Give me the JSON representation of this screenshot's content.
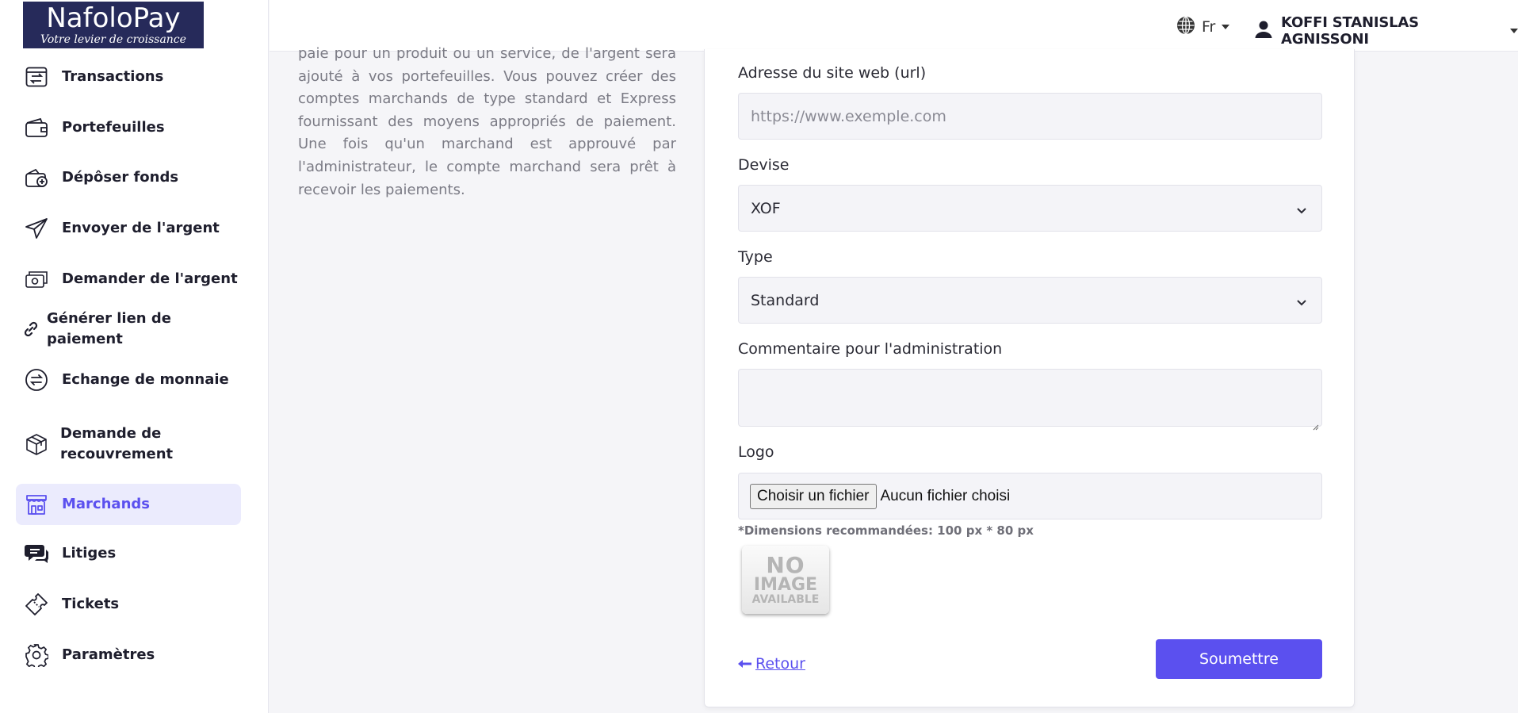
{
  "brand": {
    "name": "NafoloPay",
    "tagline": "Votre levier de croissance"
  },
  "sidebar": {
    "items": [
      {
        "label": "Transactions",
        "icon": "transactions-icon"
      },
      {
        "label": "Portefeuilles",
        "icon": "wallet-icon"
      },
      {
        "label": "Dépôser fonds",
        "icon": "deposit-wallet-icon"
      },
      {
        "label": "Envoyer de l'argent",
        "icon": "paper-plane-icon"
      },
      {
        "label": "Demander de l'argent",
        "icon": "money-request-icon"
      },
      {
        "label": "Générer lien de paiement",
        "icon": "link-icon"
      },
      {
        "label": "Echange de monnaie",
        "icon": "exchange-icon"
      },
      {
        "label": "Demande de recouvrement",
        "icon": "box-icon"
      },
      {
        "label": "Marchands",
        "icon": "store-icon",
        "active": true
      },
      {
        "label": "Litiges",
        "icon": "chat-icon"
      },
      {
        "label": "Tickets",
        "icon": "ticket-icon"
      },
      {
        "label": "Paramètres",
        "icon": "gear-icon"
      }
    ]
  },
  "header": {
    "language": "Fr",
    "user_name": "KOFFI STANISLAS AGNISSONI"
  },
  "intro_text": "paie pour un produit ou un service, de l'argent sera ajouté à vos portefeuilles. Vous pouvez créer des comptes marchands de type standard et Express fournissant des moyens appropriés de paiement. Une fois qu'un marchand est approuvé par l'administrateur, le compte marchand sera prêt à recevoir les paiements.",
  "form": {
    "website": {
      "label": "Adresse du site web (url)",
      "value": "",
      "placeholder": "https://www.exemple.com"
    },
    "currency": {
      "label": "Devise",
      "selected": "XOF"
    },
    "type": {
      "label": "Type",
      "selected": "Standard"
    },
    "comment": {
      "label": "Commentaire pour l'administration",
      "value": ""
    },
    "logo": {
      "label": "Logo",
      "button_label": "Choisir un fichier",
      "status": "Aucun fichier choisi",
      "hint": "*Dimensions recommandées: 100 px * 80 px",
      "placeholder_lines": [
        "NO",
        "IMAGE",
        "AVAILABLE"
      ]
    },
    "back_label": "Retour",
    "submit_label": "Soumettre"
  },
  "colors": {
    "accent": "#5b50ef",
    "brand_bg": "#262a5a",
    "active_bg": "#ebebfd"
  }
}
